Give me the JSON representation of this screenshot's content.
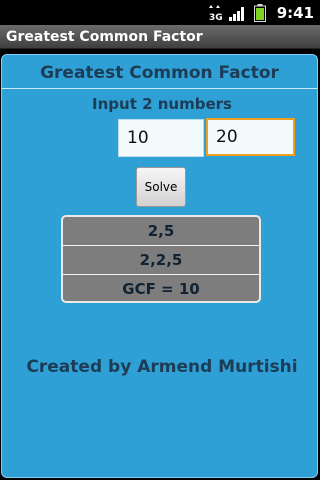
{
  "status_bar": {
    "time": "9:41",
    "network_label": "3G",
    "icons": [
      "data-transfer-icon",
      "signal-icon",
      "battery-icon"
    ]
  },
  "app": {
    "title": "Greatest Common Factor"
  },
  "main": {
    "heading": "Greatest Common Factor",
    "subheading": "Input 2 numbers",
    "input1_value": "10",
    "input2_value": "20",
    "solve_label": "Solve",
    "results": [
      "2,5",
      "2,2,5",
      "GCF = 10"
    ],
    "credit": "Created by Armend Murtishi"
  },
  "colors": {
    "background": "#2fa0d5",
    "text": "#1d3c55",
    "results_bg": "#7d7d7d",
    "focus_border": "#f0a020"
  }
}
